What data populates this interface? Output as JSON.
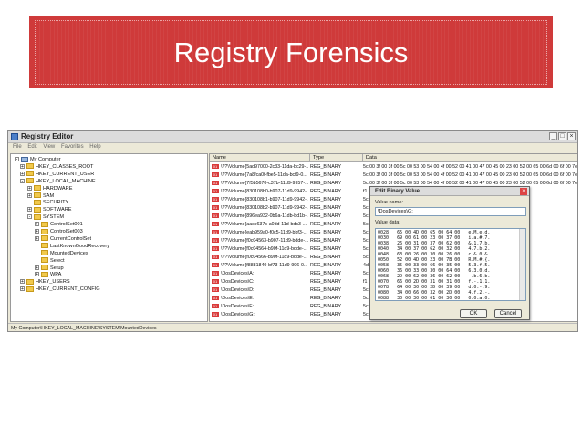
{
  "slide": {
    "title": "Registry Forensics"
  },
  "window": {
    "title": "Registry Editor",
    "menu": [
      "File",
      "Edit",
      "View",
      "Favorites",
      "Help"
    ]
  },
  "tree": [
    {
      "label": "My Computer",
      "x": 8,
      "icon": "pc",
      "exp": "-"
    },
    {
      "label": "HKEY_CLASSES_ROOT",
      "x": 14,
      "icon": "folder",
      "exp": "+"
    },
    {
      "label": "HKEY_CURRENT_USER",
      "x": 14,
      "icon": "folder",
      "exp": "+"
    },
    {
      "label": "HKEY_LOCAL_MACHINE",
      "x": 14,
      "icon": "folder",
      "exp": "-"
    },
    {
      "label": "HARDWARE",
      "x": 22,
      "icon": "folder",
      "exp": "+"
    },
    {
      "label": "SAM",
      "x": 22,
      "icon": "folder",
      "exp": "+"
    },
    {
      "label": "SECURITY",
      "x": 22,
      "icon": "folder",
      "exp": ""
    },
    {
      "label": "SOFTWARE",
      "x": 22,
      "icon": "folder",
      "exp": "+"
    },
    {
      "label": "SYSTEM",
      "x": 22,
      "icon": "folder",
      "exp": "-"
    },
    {
      "label": "ControlSet001",
      "x": 30,
      "icon": "folder",
      "exp": "+"
    },
    {
      "label": "ControlSet003",
      "x": 30,
      "icon": "folder",
      "exp": "+"
    },
    {
      "label": "CurrentControlSet",
      "x": 30,
      "icon": "folder",
      "exp": "+"
    },
    {
      "label": "LastKnownGoodRecovery",
      "x": 30,
      "icon": "folder",
      "exp": ""
    },
    {
      "label": "MountedDevices",
      "x": 30,
      "icon": "folder",
      "exp": ""
    },
    {
      "label": "Select",
      "x": 30,
      "icon": "folder",
      "exp": ""
    },
    {
      "label": "Setup",
      "x": 30,
      "icon": "folder",
      "exp": "+"
    },
    {
      "label": "WPA",
      "x": 30,
      "icon": "folder",
      "exp": "+"
    },
    {
      "label": "HKEY_USERS",
      "x": 14,
      "icon": "folder",
      "exp": "+"
    },
    {
      "label": "HKEY_CURRENT_CONFIG",
      "x": 14,
      "icon": "folder",
      "exp": "+"
    }
  ],
  "columns": [
    "Name",
    "Type",
    "Data"
  ],
  "rows": [
    {
      "name": "\\??\\Volume{5ad97000-2c33-11da-bc29-...",
      "type": "REG_BINARY",
      "data": "5c 00 3f 00 3f 00 5c 00 53 00 54 00 4f 00 52 00 41 00 47 00 45 00 23 00 52 00 65 00 6d 00 6f 00 7e"
    },
    {
      "name": "\\??\\Volume{7a8fca0f-fbe5-11da-bcf9-0...",
      "type": "REG_BINARY",
      "data": "5c 00 3f 00 3f 00 5c 00 53 00 54 00 4f 00 52 00 41 00 47 00 45 00 23 00 52 00 65 00 6d 00 6f 00 7e"
    },
    {
      "name": "\\??\\Volume{7f5b5670-c37b-11d9-9957-...",
      "type": "REG_BINARY",
      "data": "5c 00 3f 00 3f 00 5c 00 53 00 54 00 4f 00 52 00 41 00 47 00 45 00 23 00 52 00 65 00 6d 00 6f 00 7e"
    },
    {
      "name": "\\??\\Volume{830108b0-b907-11d9-9942-...",
      "type": "REG_BINARY",
      "data": "f1 4f"
    },
    {
      "name": "\\??\\Volume{830108b1-b907-11d9-9942-...",
      "type": "REG_BINARY",
      "data": "5c 00"
    },
    {
      "name": "\\??\\Volume{830108b2-b907-11d9-9942-...",
      "type": "REG_BINARY",
      "data": "5c 00"
    },
    {
      "name": "\\??\\Volume{896ea932-0b6a-11db-bd1b-...",
      "type": "REG_BINARY",
      "data": "5c 00"
    },
    {
      "name": "\\??\\Volume{aacc637c-a0dd-11d-bdc3-...",
      "type": "REG_BINARY",
      "data": "5c 00"
    },
    {
      "name": "\\??\\Volume{eab959a0-f0c5-11d9-bbf3-...",
      "type": "REG_BINARY",
      "data": "5c 00"
    },
    {
      "name": "\\??\\Volume{f0c04563-b907-11d9-bdde-...",
      "type": "REG_BINARY",
      "data": "5c 00"
    },
    {
      "name": "\\??\\Volume{f0c04564-b90f-11d9-bdde-...",
      "type": "REG_BINARY",
      "data": "5c 00"
    },
    {
      "name": "\\??\\Volume{f0c04566-b90f-11d9-bdde-...",
      "type": "REG_BINARY",
      "data": "5c 00"
    },
    {
      "name": "\\??\\Volume{f8881840-bf73-11d9-996-0...",
      "type": "REG_BINARY",
      "data": "4d 6"
    },
    {
      "name": "\\DosDevices\\A:",
      "type": "REG_BINARY",
      "data": "5c 00"
    },
    {
      "name": "\\DosDevices\\C:",
      "type": "REG_BINARY",
      "data": "f1 4f"
    },
    {
      "name": "\\DosDevices\\D:",
      "type": "REG_BINARY",
      "data": "5c 00"
    },
    {
      "name": "\\DosDevices\\E:",
      "type": "REG_BINARY",
      "data": "5c 00"
    },
    {
      "name": "\\DosDevices\\F:",
      "type": "REG_BINARY",
      "data": "5c 00"
    },
    {
      "name": "\\DosDevices\\G:",
      "type": "REG_BINARY",
      "data": "5c 00"
    }
  ],
  "status": "My Computer\\HKEY_LOCAL_MACHINE\\SYSTEM\\MountedDevices",
  "dialog": {
    "title": "Edit Binary Value",
    "value_name_label": "Value name:",
    "value_name": "\\DosDevices\\G:",
    "value_data_label": "Value data:",
    "hex": [
      "0028   65 00 4D 00 65 00 64 00   e.M.e.d.",
      "0030   69 00 61 00 23 00 37 00   i.a.#.7.",
      "0038   26 00 31 00 37 00 62 00   &.1.7.b.",
      "0040   34 00 37 00 62 00 32 00   4.7.b.2.",
      "0048   63 00 26 00 30 00 26 00   c.&.0.&.",
      "0050   52 00 4D 00 23 00 7B 00   R.M.#.{.",
      "0058   35 00 33 00 66 00 35 00   5.3.f.5.",
      "0060   36 00 33 00 30 00 64 00   6.3.0.d.",
      "0068   2D 00 62 00 36 00 62 00   -.b.6.b.",
      "0070   66 00 2D 00 31 00 31 00   f.-.1.1.",
      "0078   64 00 30 00 2D 00 39 00   d.0.-.9.",
      "0080   34 00 66 00 32 00 2D 00   4.f.2.-.",
      "0088   30 00 30 00 61 00 30 00   0.0.a.0."
    ],
    "ok": "OK",
    "cancel": "Cancel"
  }
}
